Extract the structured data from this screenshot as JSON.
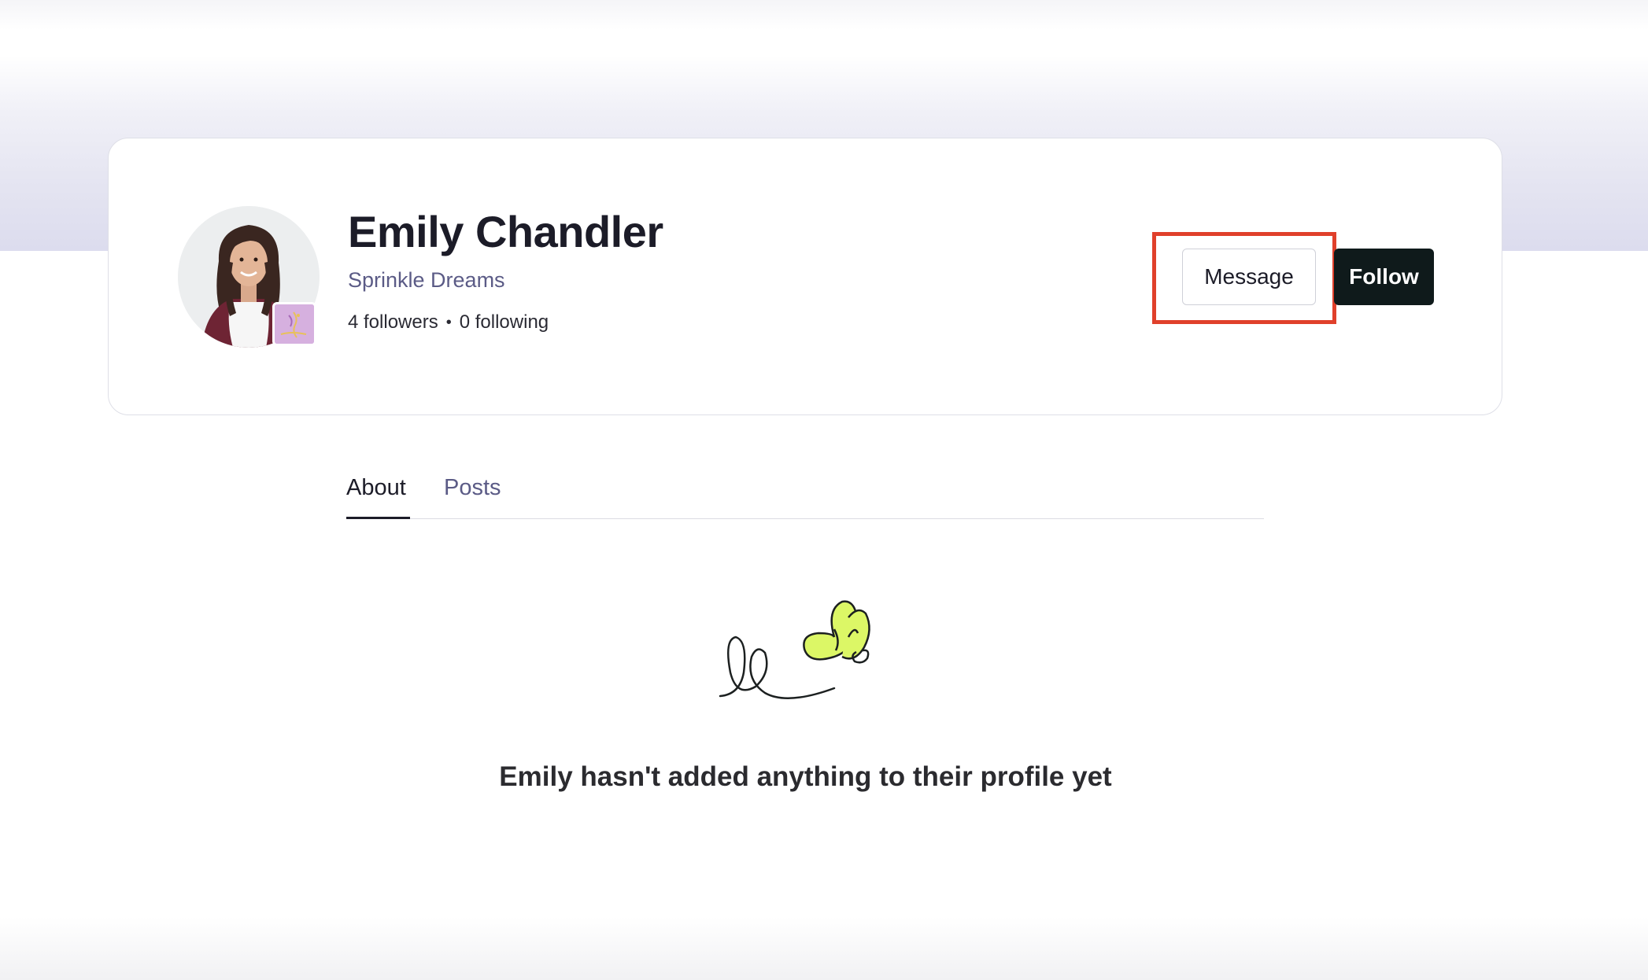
{
  "profile": {
    "name": "Emily Chandler",
    "business": "Sprinkle Dreams",
    "followers_label": "4 followers",
    "separator": "•",
    "following_label": "0 following",
    "avatar_icon": "person-photo",
    "badge_icon": "business-logo"
  },
  "actions": {
    "message_label": "Message",
    "follow_label": "Follow"
  },
  "tabs": [
    {
      "label": "About",
      "active": true
    },
    {
      "label": "Posts",
      "active": false
    }
  ],
  "empty_state": {
    "illustration_icon": "doodle-leaves-icon",
    "message": "Emily hasn't added anything to their profile yet"
  },
  "colors": {
    "highlight": "#e0402b",
    "follow_bg": "#0f1a1b",
    "accent_text": "#5b5b86",
    "leaf_fill": "#dcf766"
  }
}
